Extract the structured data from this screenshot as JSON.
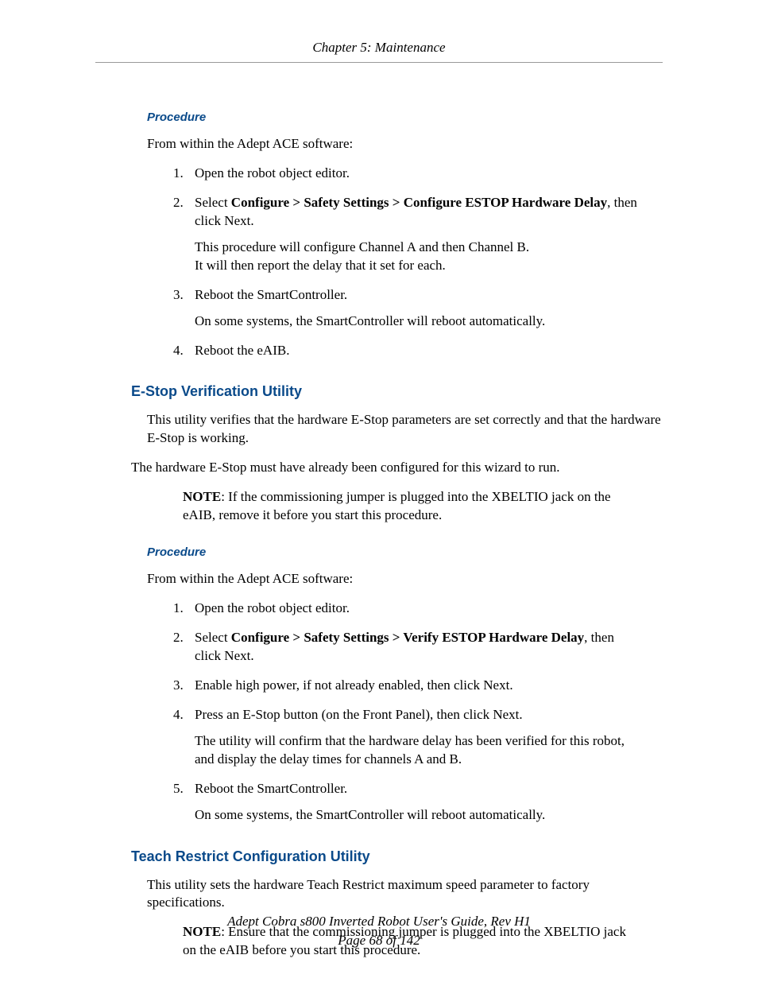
{
  "header": {
    "chapter": "Chapter 5: Maintenance"
  },
  "sections": {
    "proc1_heading": "Procedure",
    "proc1_intro": "From within the Adept ACE software:",
    "proc1_items": {
      "i1": "Open the robot object editor.",
      "i2a": "Select ",
      "i2b_bold": "Configure > Safety Settings > Configure ESTOP Hardware Delay",
      "i2c": ", then click Next.",
      "i2p1": "This procedure will configure Channel A and then Channel B.",
      "i2p2": "It will then report the delay that it set for each.",
      "i3": "Reboot the SmartController.",
      "i3p": "On some systems, the SmartController will reboot automatically.",
      "i4": "Reboot the eAIB."
    },
    "estop_heading": "E-Stop Verification Utility",
    "estop_p1": "This utility verifies that the hardware E-Stop parameters are set correctly and that the hardware E-Stop is working.",
    "estop_p2": "The hardware E-Stop must have already been configured for this wizard to run.",
    "estop_note_label": "NOTE",
    "estop_note_text": ": If the commissioning jumper is plugged into the XBELTIO jack on the eAIB, remove it before you start this procedure.",
    "proc2_heading": "Procedure",
    "proc2_intro": "From within the Adept ACE software:",
    "proc2_items": {
      "i1": "Open the robot object editor.",
      "i2a": "Select ",
      "i2b_bold": "Configure > Safety Settings > Verify ESTOP Hardware Delay",
      "i2c": ", then click Next.",
      "i3": "Enable high power, if not already enabled, then click Next.",
      "i4": "Press an E-Stop button (on the Front Panel), then click Next.",
      "i4p": "The utility will confirm that the hardware delay has been verified for this robot, and display the delay times for channels A and B.",
      "i5": "Reboot the SmartController.",
      "i5p": "On some systems, the SmartController will reboot automatically."
    },
    "teach_heading": "Teach Restrict Configuration Utility",
    "teach_p1": "This utility sets the hardware Teach Restrict maximum speed parameter to factory specifications.",
    "teach_note_label": "NOTE",
    "teach_note_text": ": Ensure that the commissioning jumper is plugged into the XBELTIO jack on the eAIB before you start this procedure."
  },
  "footer": {
    "title": "Adept Cobra s800 Inverted Robot User's Guide, Rev H1",
    "page": "Page 68 of 142"
  }
}
